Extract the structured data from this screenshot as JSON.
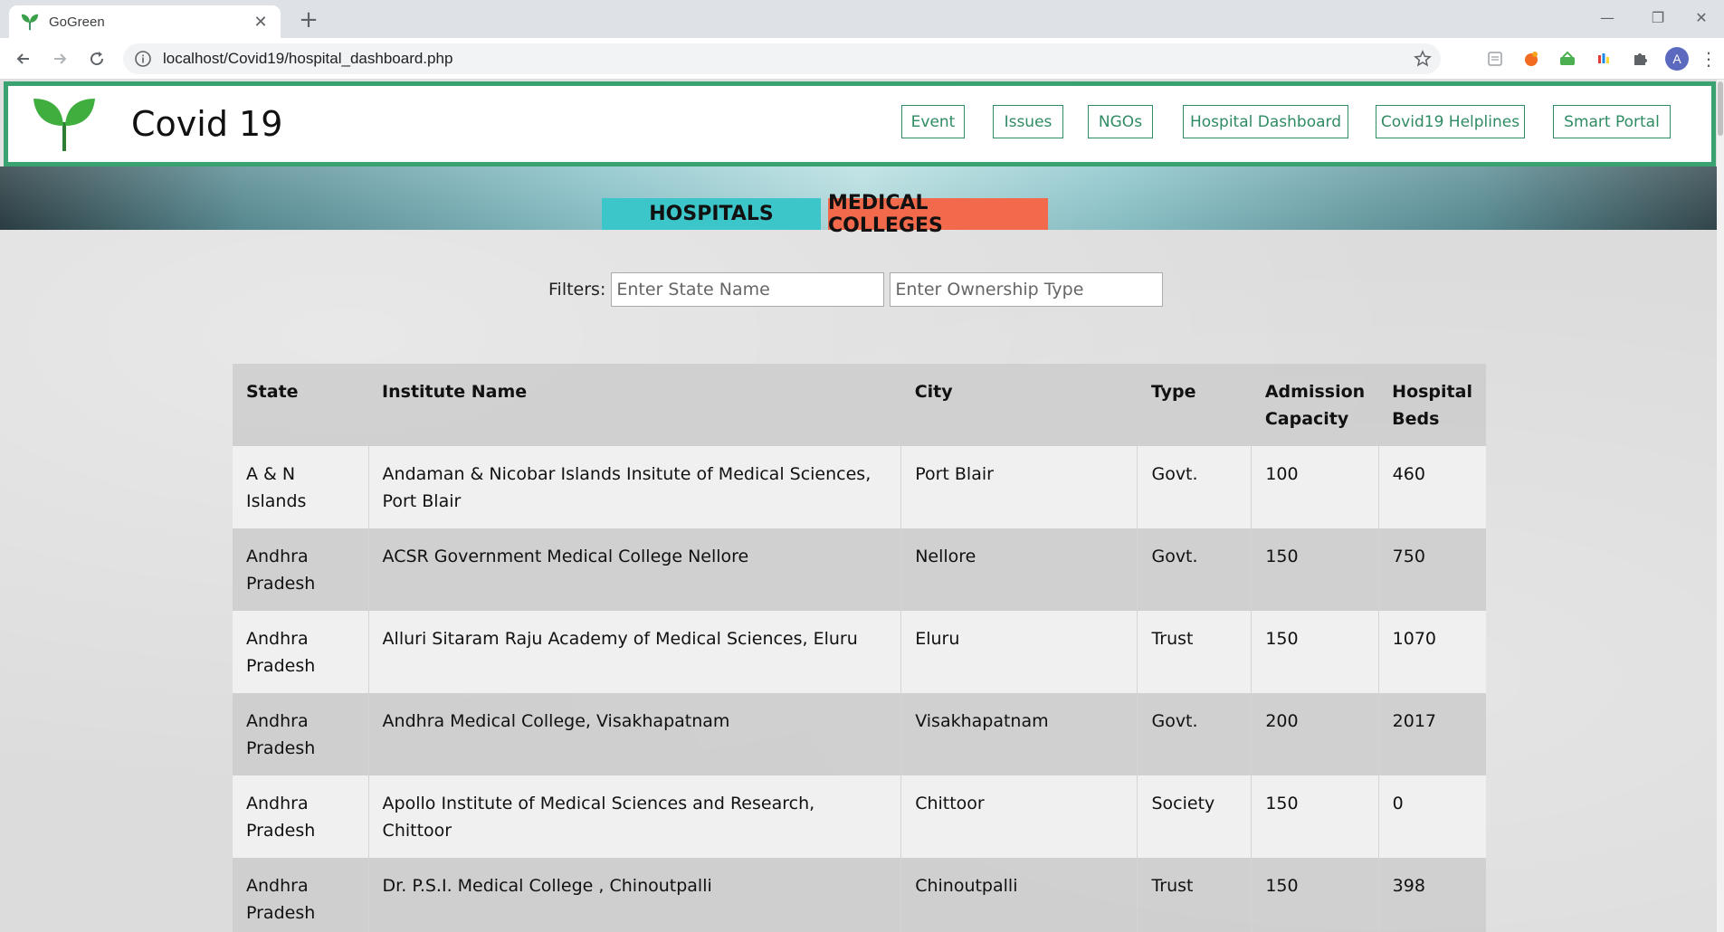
{
  "browser": {
    "tab_title": "GoGreen",
    "url": "localhost/Covid19/hospital_dashboard.php",
    "profile_initial": "A"
  },
  "site": {
    "title": "Covid 19",
    "nav": [
      "Event",
      "Issues",
      "NGOs",
      "Hospital Dashboard",
      "Covid19 Helplines",
      "Smart Portal"
    ],
    "accent_color": "#3aa170"
  },
  "segments": {
    "hospitals": "HOSPITALS",
    "medical_colleges": "MEDICAL COLLEGES",
    "hospitals_color": "#3cc6c9",
    "medical_colleges_color": "#f26a4b"
  },
  "filters": {
    "label": "Filters:",
    "state_placeholder": "Enter State Name",
    "ownership_placeholder": "Enter Ownership Type"
  },
  "table": {
    "headers": [
      "State",
      "Institute Name",
      "City",
      "Type",
      "Admission Capacity",
      "Hospital Beds"
    ],
    "rows": [
      [
        "A & N Islands",
        "Andaman & Nicobar Islands Insitute of Medical Sciences, Port Blair",
        "Port Blair",
        "Govt.",
        "100",
        "460"
      ],
      [
        "Andhra Pradesh",
        "ACSR Government Medical College Nellore",
        "Nellore",
        "Govt.",
        "150",
        "750"
      ],
      [
        "Andhra Pradesh",
        "Alluri Sitaram Raju Academy of Medical Sciences, Eluru",
        "Eluru",
        "Trust",
        "150",
        "1070"
      ],
      [
        "Andhra Pradesh",
        "Andhra Medical College, Visakhapatnam",
        "Visakhapatnam",
        "Govt.",
        "200",
        "2017"
      ],
      [
        "Andhra Pradesh",
        "Apollo Institute of Medical Sciences and Research, Chittoor",
        "Chittoor",
        "Society",
        "150",
        "0"
      ],
      [
        "Andhra Pradesh",
        "Dr. P.S.I. Medical College , Chinoutpalli",
        "Chinoutpalli",
        "Trust",
        "150",
        "398"
      ]
    ]
  }
}
